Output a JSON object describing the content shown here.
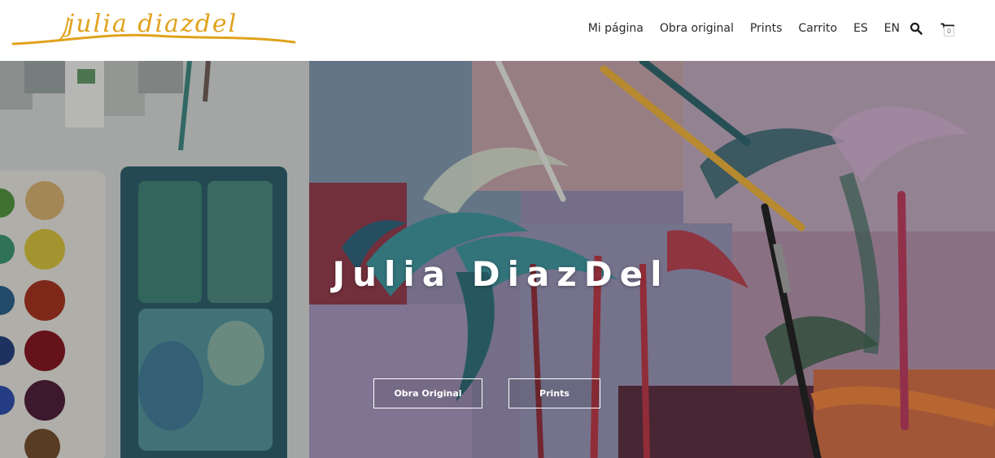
{
  "brand": {
    "logo_text": "julia diazdel",
    "logo_color": "#e0a21c"
  },
  "nav": {
    "items": [
      {
        "id": "mi-pagina",
        "label": "Mi página"
      },
      {
        "id": "obra-original",
        "label": "Obra original"
      },
      {
        "id": "prints",
        "label": "Prints"
      },
      {
        "id": "carrito",
        "label": "Carrito"
      },
      {
        "id": "es",
        "label": "ES"
      },
      {
        "id": "en",
        "label": "EN"
      }
    ],
    "search_icon": "search-icon",
    "cart_icon": "cart-icon",
    "cart_count": "0"
  },
  "hero": {
    "title": "Julia DiazDel",
    "buttons": {
      "original": "Obra Original",
      "prints": "Prints"
    }
  }
}
